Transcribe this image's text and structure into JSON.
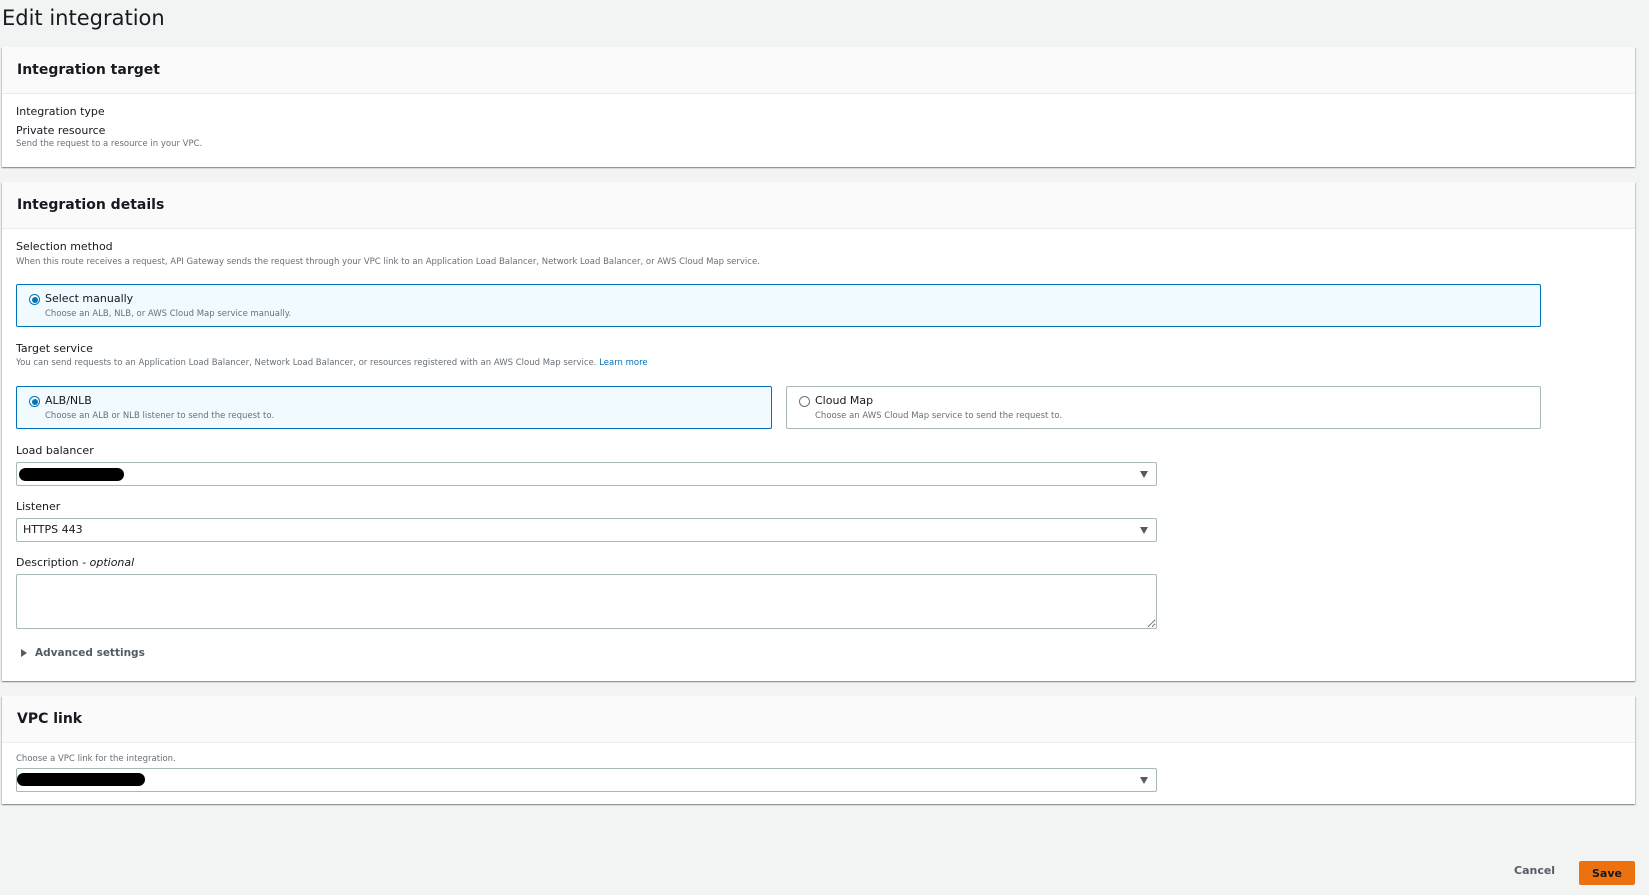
{
  "page": {
    "title": "Edit integration"
  },
  "integration_target": {
    "heading": "Integration target",
    "type_label": "Integration type",
    "type_value": "Private resource",
    "type_desc": "Send the request to a resource in your VPC."
  },
  "integration_details": {
    "heading": "Integration details",
    "selection_method": {
      "label": "Selection method",
      "desc": "When this route receives a request, API Gateway sends the request through your VPC link to an Application Load Balancer, Network Load Balancer, or AWS Cloud Map service.",
      "options": [
        {
          "label": "Select manually",
          "desc": "Choose an ALB, NLB, or AWS Cloud Map service manually.",
          "selected": true
        }
      ]
    },
    "target_service": {
      "label": "Target service",
      "desc": "You can send requests to an Application Load Balancer, Network Load Balancer, or resources registered with an AWS Cloud Map service.",
      "learn_more": "Learn more",
      "options": [
        {
          "label": "ALB/NLB",
          "desc": "Choose an ALB or NLB listener to send the request to.",
          "selected": true
        },
        {
          "label": "Cloud Map",
          "desc": "Choose an AWS Cloud Map service to send the request to.",
          "selected": false
        }
      ]
    },
    "load_balancer": {
      "label": "Load balancer",
      "value": "",
      "redacted": true
    },
    "listener": {
      "label": "Listener",
      "value": "HTTPS 443"
    },
    "description": {
      "label": "Description",
      "optional": "- optional",
      "value": ""
    },
    "advanced": {
      "label": "Advanced settings",
      "expanded": false
    }
  },
  "vpc_link": {
    "heading": "VPC link",
    "desc": "Choose a VPC link for the integration.",
    "value": "",
    "redacted": true
  },
  "actions": {
    "cancel": "Cancel",
    "save": "Save"
  },
  "colors": {
    "accent": "#0073bb",
    "primary_button": "#ec7211"
  },
  "icons": {
    "select_caret": "caret-down-icon",
    "expander": "caret-right-icon"
  }
}
